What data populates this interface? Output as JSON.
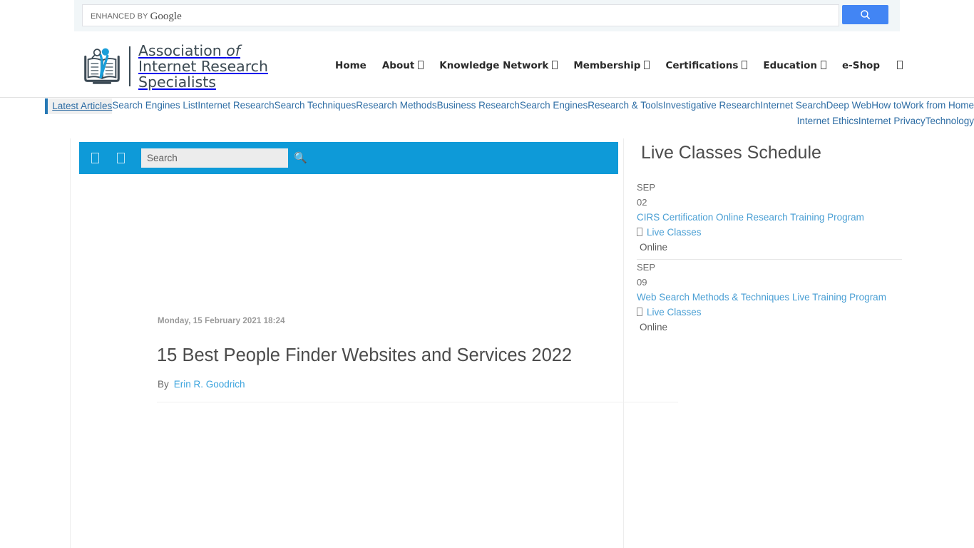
{
  "cse": {
    "branding_prefix": "ENHANCED BY",
    "branding_word": "Google",
    "placeholder": "",
    "value": "",
    "search_button_icon": "search-icon",
    "button_color": "#4285f4"
  },
  "header": {
    "logo": {
      "icon": "book-magnifier-logo-icon",
      "line1_a": "Association ",
      "line1_b": "of",
      "line2": "Internet Research",
      "line3": "Specialists"
    },
    "nav": [
      {
        "label": "Home",
        "has_dropdown": false
      },
      {
        "label": "About",
        "has_dropdown": true
      },
      {
        "label": "Knowledge Network",
        "has_dropdown": true
      },
      {
        "label": "Membership",
        "has_dropdown": true
      },
      {
        "label": "Certifications",
        "has_dropdown": true
      },
      {
        "label": "Education",
        "has_dropdown": true
      },
      {
        "label": "e-Shop",
        "has_dropdown": false
      }
    ],
    "nav_extra_icon": "menu-box-icon"
  },
  "tags": {
    "first": "Latest Articles",
    "accent_color": "#2779b5",
    "items": [
      "Search Engines List",
      "Internet Research",
      "Search Techniques",
      "Research Methods",
      "Business Research",
      "Search Engines",
      "Research & Tools",
      "Investigative Research",
      "Internet Search",
      "Deep Web",
      "How to",
      "Work from Home",
      "Internet Ethics",
      "Internet Privacy",
      "Technology"
    ]
  },
  "article": {
    "toolbar": {
      "bar_color": "#0e9ad8",
      "icon1": "font-size-icon",
      "icon2": "print-icon",
      "search_placeholder": "Search",
      "search_value": "",
      "search_icon": "magnifier-icon"
    },
    "date": "Monday, 15 February 2021 18:24",
    "title": "15 Best People Finder Websites and Services 2022",
    "by_label": "By",
    "author": "Erin R. Goodrich"
  },
  "sidebar": {
    "title": "Live Classes Schedule",
    "events": [
      {
        "month": "SEP",
        "day": "02",
        "name": "CIRS Certification Online Research Training Program",
        "category": "Live Classes",
        "category_icon": "calendar-icon",
        "location": "Online"
      },
      {
        "month": "SEP",
        "day": "09",
        "name": "Web Search Methods & Techniques Live Training Program",
        "category": "Live Classes",
        "category_icon": "calendar-icon",
        "location": "Online"
      }
    ]
  }
}
